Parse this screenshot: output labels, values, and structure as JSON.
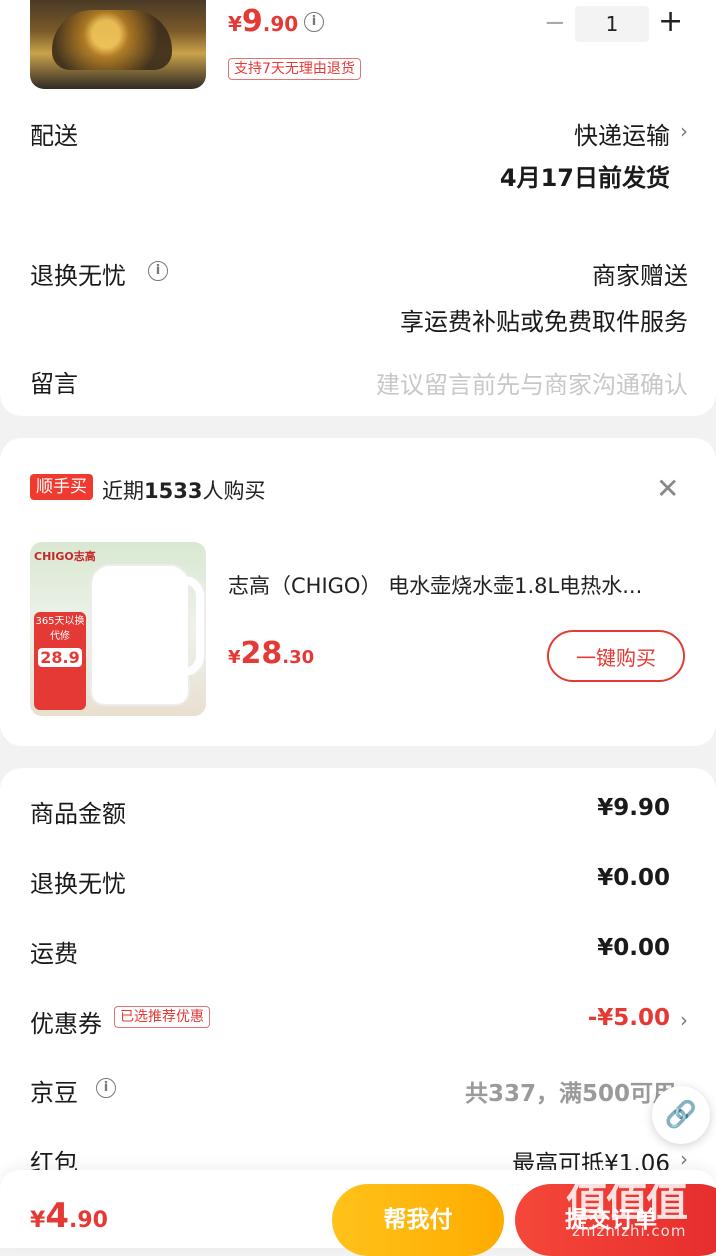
{
  "product_top": {
    "price": {
      "currency": "¥",
      "integer": "9",
      "decimal": ".90"
    },
    "return_tag": "支持7天无理由退货",
    "quantity": "1",
    "minus": "−",
    "plus": "+"
  },
  "delivery": {
    "label": "配送",
    "method": "快递运输",
    "date": "4月17日前发货"
  },
  "worry_free": {
    "label": "退换无忧",
    "value": "商家赠送",
    "desc": "享运费补贴或免费取件服务"
  },
  "message": {
    "label": "留言",
    "placeholder": "建议留言前先与商家沟通确认"
  },
  "convenient_buy": {
    "badge": "顺手买",
    "title_prefix": "近期",
    "count": "1533",
    "title_suffix": "人购买",
    "product_name": "志高（CHIGO） 电水壶烧水壶1.8L电热水...",
    "price": {
      "currency": "¥",
      "integer": "28",
      "decimal": ".30"
    },
    "buy_button": "一键购买",
    "image_brand": "CHIGO志高",
    "image_promo_top": "365天以换代修",
    "image_promo_price": "28.9"
  },
  "summary": {
    "items": [
      {
        "label": "商品金额",
        "value": "¥9.90"
      },
      {
        "label": "退换无忧",
        "value": "¥0.00"
      },
      {
        "label": "运费",
        "value": "¥0.00"
      },
      {
        "label": "优惠券",
        "tag": "已选推荐优惠",
        "value": "-¥5.00"
      },
      {
        "label": "京豆",
        "value": "共337，满500可用"
      },
      {
        "label": "红包",
        "value": "最高可抵¥1.06"
      }
    ]
  },
  "footer": {
    "total": {
      "currency": "¥",
      "integer": "4",
      "decimal": ".90"
    },
    "help_pay": "帮我付",
    "submit": "提交订单"
  },
  "watermark": {
    "main": "值值值",
    "sub": "zhizhizhi.com"
  },
  "colors": {
    "accent": "#e53935",
    "yellow": "#ffb300"
  }
}
